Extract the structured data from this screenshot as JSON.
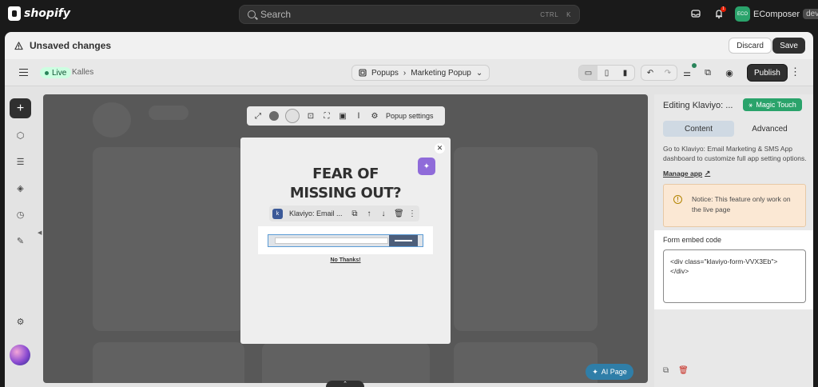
{
  "topbar": {
    "brand": "shopify",
    "search_placeholder": "Search",
    "shortcut_ctrl": "CTRL",
    "shortcut_key": "K",
    "notification_count": "1",
    "store_initials": "ECO",
    "store_name": "EComposer",
    "store_badge": "dev"
  },
  "unsaved": {
    "message": "Unsaved changes",
    "discard_label": "Discard",
    "save_label": "Save"
  },
  "editor": {
    "status": "Live",
    "theme_name": "Kalles",
    "breadcrumb_section": "Popups",
    "breadcrumb_page": "Marketing Popup",
    "publish_label": "Publish"
  },
  "canvas": {
    "toolbar_settings_label": "Popup settings",
    "popup_title": "FEAR OF MISSING OUT?",
    "element_label": "Klaviyo: Email ...",
    "no_thanks": "No Thanks!",
    "ai_page_label": "AI Page"
  },
  "panel": {
    "title": "Editing Klaviyo: ...",
    "magic_touch_label": "Magic Touch",
    "tab_content": "Content",
    "tab_advanced": "Advanced",
    "description": "Go to Klaviyo: Email Marketing & SMS App dashboard to customize full app setting options.",
    "manage_link": "Manage app",
    "notice": "Notice: This feature only work on the live page",
    "embed_label": "Form embed code",
    "embed_value": "<div class=\"klaviyo-form-VVX3Eb\">\n</div>"
  },
  "colors": {
    "accent_green": "#2aa36b",
    "notice_bg": "#fbe8d4",
    "live_badge_bg": "#cdfee1",
    "ai_page_bg": "#2f7ea8"
  }
}
